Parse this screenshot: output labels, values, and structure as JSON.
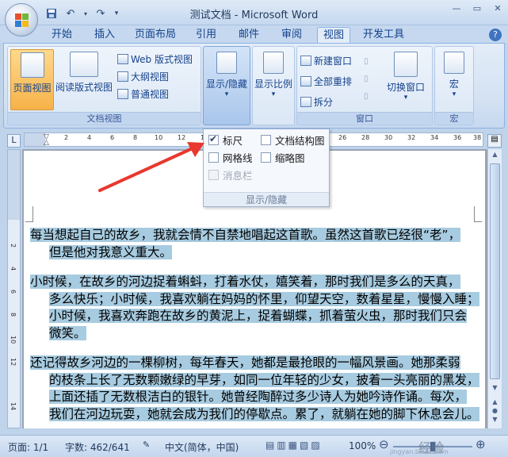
{
  "window": {
    "title": "测试文档 - Microsoft Word",
    "controls": [
      "minimize",
      "maximize",
      "close"
    ]
  },
  "qat": {
    "icons": [
      "save-icon",
      "undo-icon",
      "redo-icon",
      "customize-icon"
    ]
  },
  "tabs": [
    "开始",
    "插入",
    "页面布局",
    "引用",
    "邮件",
    "审阅",
    "视图",
    "开发工具"
  ],
  "active_tab": "视图",
  "ribbon": {
    "doc_views": {
      "label": "文档视图",
      "print_layout": "页面视图",
      "reading": "阅读版式视图",
      "web": "Web 版式视图",
      "outline": "大纲视图",
      "draft": "普通视图"
    },
    "show_hide": {
      "label": "显示/隐藏"
    },
    "zoom": {
      "label": "显示比例"
    },
    "window": {
      "label": "窗口",
      "new_window": "新建窗口",
      "arrange_all": "全部重排",
      "split": "拆分",
      "switch": "切换窗口"
    },
    "macros": {
      "label": "宏",
      "button": "宏"
    }
  },
  "dropdown": {
    "items": [
      {
        "label": "标尺",
        "checked": true,
        "enabled": true
      },
      {
        "label": "文档结构图",
        "checked": false,
        "enabled": true
      },
      {
        "label": "网格线",
        "checked": false,
        "enabled": true
      },
      {
        "label": "缩略图",
        "checked": false,
        "enabled": true
      },
      {
        "label": "消息栏",
        "checked": false,
        "enabled": false
      }
    ],
    "footer": "显示/隐藏"
  },
  "ruler": {
    "ticks": [
      "2",
      "4",
      "6",
      "8",
      "10",
      "12",
      "14",
      "26",
      "28",
      "30",
      "32",
      "34",
      "36",
      "38"
    ]
  },
  "vruler": {
    "ticks": [
      "2",
      "4",
      "6",
      "8",
      "10",
      "12",
      "14"
    ]
  },
  "document": {
    "paragraphs": [
      {
        "line1": "每当想起自己的故乡，我就会情不自禁地唱起这首歌。虽然这首歌已经很“老”，",
        "rest": [
          "但是他对我意义重大。"
        ]
      },
      {
        "line1": "小时候，在故乡的河边捉着蝌蚪，打着水仗，嬉笑着，那时我们是多么的天真，",
        "rest": [
          "多么快乐；小时候，我喜欢躺在妈妈的怀里，仰望天空，数着星星，慢慢入睡；",
          "小时候，我喜欢奔跑在故乡的黄泥上，捉着蝴蝶，抓着萤火虫，那时我们只会",
          "微笑。"
        ]
      },
      {
        "line1": "还记得故乡河边的一棵柳树，每年春天，她都是最抢眼的一幅风景画。她那柔弱",
        "rest": [
          "的枝条上长了无数颗嫩绿的早芽，如同一位年轻的少女，披着一头亮丽的黑发，",
          "上面还插了无数根洁白的银针。她曾经陶醉过多少诗人为她吟诗作诵。每次，",
          "我们在河边玩耍，她就会成为我们的停歇点。累了，就躺在她的脚下休息会儿。"
        ]
      }
    ]
  },
  "status": {
    "page": "页面: 1/1",
    "words": "字数: 462/641",
    "lang": "中文(简体，中国)",
    "zoom": "100%"
  },
  "watermark": {
    "text": "jingyan.baidu.com",
    "brand": "经验"
  }
}
